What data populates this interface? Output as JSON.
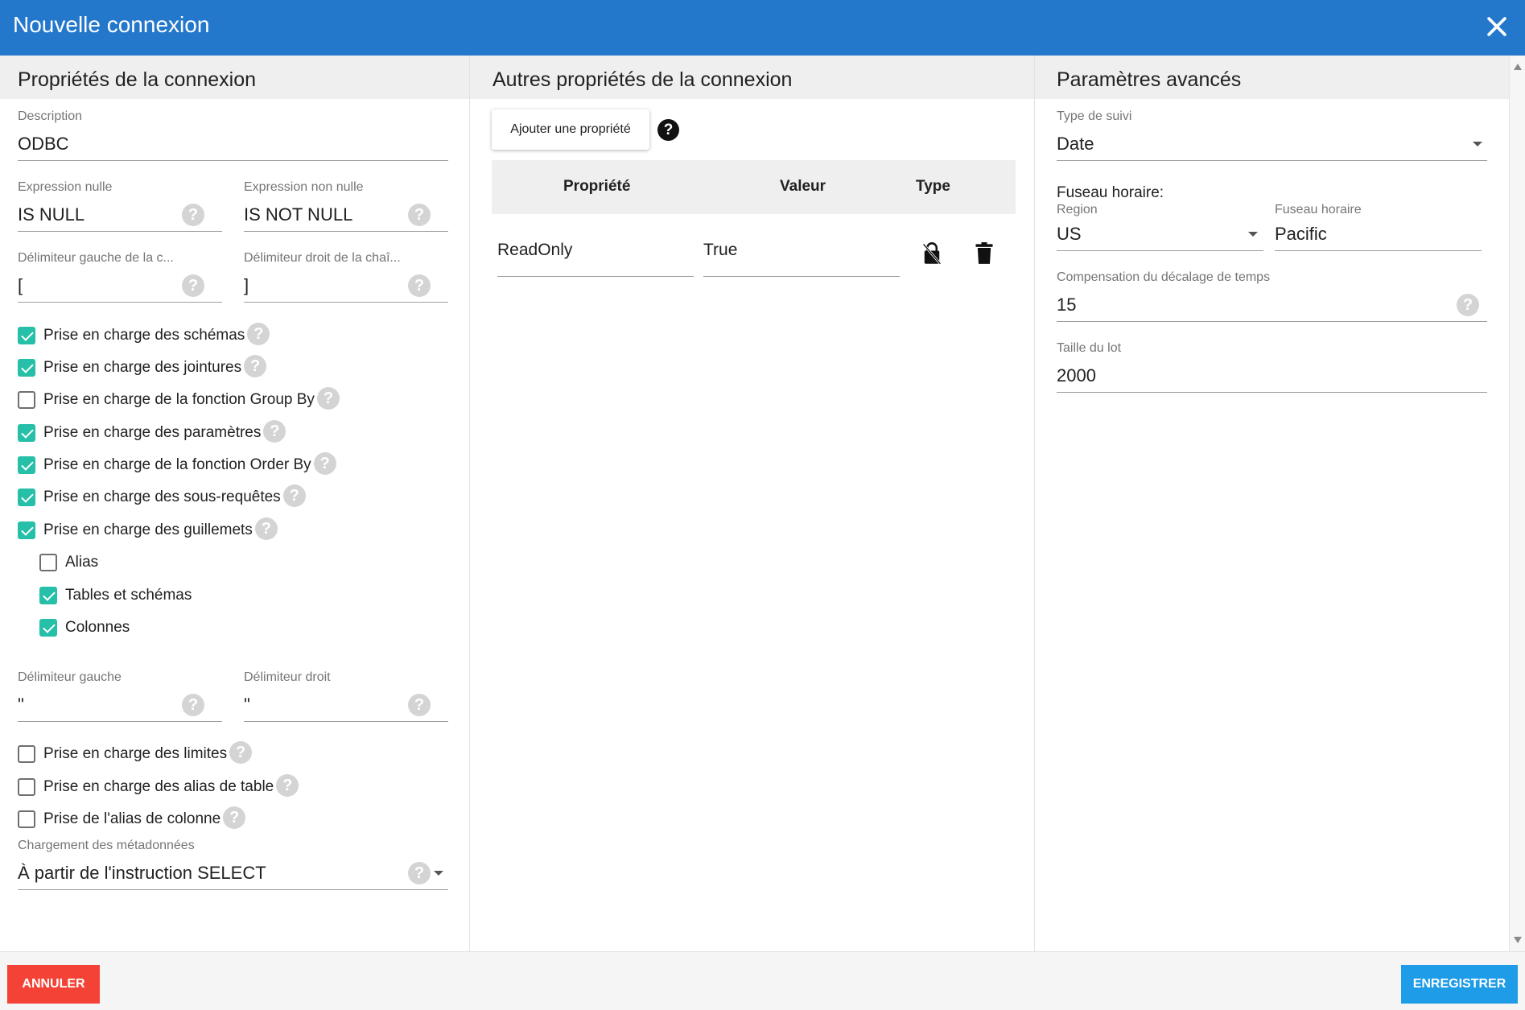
{
  "window": {
    "title": "Nouvelle connexion",
    "close_icon": "close-icon"
  },
  "connection_properties": {
    "header": "Propriétés de la connexion",
    "description": {
      "label": "Description",
      "value": "ODBC"
    },
    "null_expression": {
      "label": "Expression nulle",
      "value": "IS NULL"
    },
    "not_null_expression": {
      "label": "Expression non nulle",
      "value": "IS NOT NULL"
    },
    "left_string_delimiter": {
      "label": "Délimiteur gauche de la c...",
      "value": "["
    },
    "right_string_delimiter": {
      "label": "Délimiteur droit de la chaî...",
      "value": "]"
    },
    "checkboxes": [
      {
        "label": "Prise en charge des schémas",
        "checked": true
      },
      {
        "label": "Prise en charge des jointures",
        "checked": true
      },
      {
        "label": "Prise en charge de la fonction Group By",
        "checked": false
      },
      {
        "label": "Prise en charge des paramètres",
        "checked": true
      },
      {
        "label": "Prise en charge de la fonction Order By",
        "checked": true
      },
      {
        "label": "Prise en charge des sous-requêtes",
        "checked": true
      },
      {
        "label": "Prise en charge des guillemets",
        "checked": true
      }
    ],
    "quote_options": [
      {
        "label": "Alias",
        "checked": false
      },
      {
        "label": "Tables et schémas",
        "checked": true
      },
      {
        "label": "Colonnes",
        "checked": true
      }
    ],
    "left_delimiter": {
      "label": "Délimiteur gauche",
      "value": "\""
    },
    "right_delimiter": {
      "label": "Délimiteur droit",
      "value": "\""
    },
    "checkboxes2": [
      {
        "label": "Prise en charge des limites",
        "checked": false
      },
      {
        "label": "Prise en charge des alias de table",
        "checked": false
      },
      {
        "label": "Prise de l'alias de colonne",
        "checked": false
      }
    ],
    "metadata_loading": {
      "label": "Chargement des métadonnées",
      "value": "À partir de l'instruction SELECT"
    },
    "help_glyph": "?"
  },
  "other_properties": {
    "header": "Autres propriétés de la connexion",
    "add_button": "Ajouter une propriété",
    "columns": {
      "property": "Propriété",
      "value": "Valeur",
      "type": "Type"
    },
    "rows": [
      {
        "property": "ReadOnly",
        "value": "True",
        "type_icon": "lock-icon",
        "delete_icon": "trash-icon"
      }
    ]
  },
  "advanced": {
    "header": "Paramètres avancés",
    "tracking_type": {
      "label": "Type de suivi",
      "value": "Date"
    },
    "timezone_title": "Fuseau horaire:",
    "region": {
      "label": "Region",
      "value": "US"
    },
    "timezone": {
      "label": "Fuseau horaire",
      "value": "Pacific"
    },
    "time_offset": {
      "label": "Compensation du décalage de temps",
      "value": "15"
    },
    "batch_size": {
      "label": "Taille du lot",
      "value": "2000"
    }
  },
  "footer": {
    "cancel": "ANNULER",
    "save": "ENREGISTRER"
  },
  "colors": {
    "title_bar": "#2478cc",
    "checkbox": "#26bfa8",
    "cancel": "#f44336",
    "save": "#1e9ce8"
  }
}
